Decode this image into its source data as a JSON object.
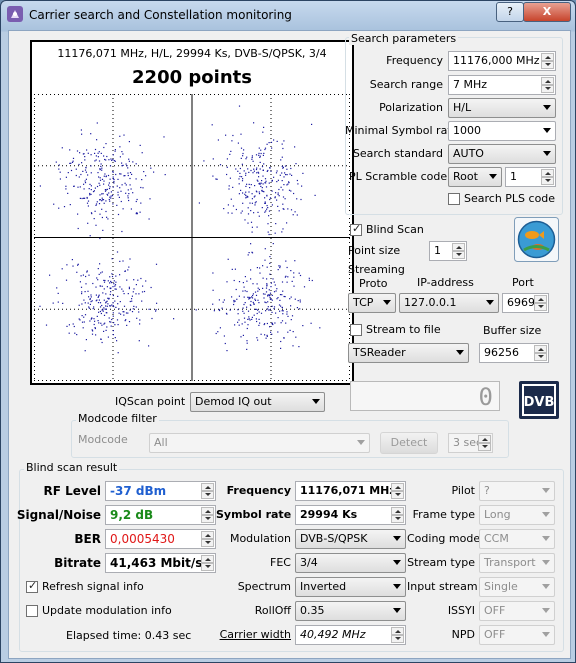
{
  "window": {
    "title": "Carrier search and Constellation monitoring",
    "help_label": "?",
    "close_label": "X"
  },
  "plot": {
    "header": "11176,071 MHz, H/L, 29994 Ks, DVB-S/QPSK, 3/4",
    "points_label": "2200 points"
  },
  "search_params": {
    "group_title": "Search parameters",
    "frequency_label": "Frequency",
    "frequency_value": "11176,000 MHz",
    "search_range_label": "Search range",
    "search_range_value": "7 MHz",
    "polarization_label": "Polarization",
    "polarization_value": "H/L",
    "min_symbol_rate_label": "Minimal Symbol rate",
    "min_symbol_rate_value": "1000",
    "search_standard_label": "Search standard",
    "search_standard_value": "AUTO",
    "pl_scramble_label": "PL Scramble code",
    "pl_scramble_mode": "Root",
    "pl_scramble_value": "1",
    "search_pls_label": "Search PLS code"
  },
  "blind": {
    "blind_scan_label": "Blind Scan",
    "point_size_label": "Point size",
    "point_size_value": "1"
  },
  "streaming": {
    "title": "Streaming",
    "proto_label": "Proto",
    "ip_label": "IP-address",
    "port_label": "Port",
    "proto_value": "TCP",
    "ip_value": "127.0.0.1",
    "port_value": "6969",
    "stream_to_file_label": "Stream to file",
    "buffer_size_label": "Buffer size",
    "reader_value": "TSReader",
    "buffer_size_value": "96256"
  },
  "iq": {
    "label": "IQScan point",
    "value": "Demod IQ out",
    "counter": "0"
  },
  "modcode": {
    "group_title": "Modcode filter",
    "label": "Modcode",
    "value": "All",
    "detect_label": "Detect",
    "interval_value": "3 sec"
  },
  "result": {
    "group_title": "Blind scan result",
    "rf_level_label": "RF Level",
    "rf_level_value": "-37 dBm",
    "snr_label": "Signal/Noise",
    "snr_value": "9,2 dB",
    "ber_label": "BER",
    "ber_value": "0,0005430",
    "bitrate_label": "Bitrate",
    "bitrate_value": "41,463 Mbit/s",
    "refresh_label": "Refresh signal info",
    "update_mod_label": "Update modulation info",
    "elapsed_label": "Elapsed time: 0.43 sec",
    "frequency_label": "Frequency",
    "frequency_value": "11176,071 MHz",
    "symbol_rate_label": "Symbol rate",
    "symbol_rate_value": "29994 Ks",
    "modulation_label": "Modulation",
    "modulation_value": "DVB-S/QPSK",
    "fec_label": "FEC",
    "fec_value": "3/4",
    "spectrum_label": "Spectrum",
    "spectrum_value": "Inverted",
    "rolloff_label": "RollOff",
    "rolloff_value": "0.35",
    "carrier_width_label": "Carrier width",
    "carrier_width_value": "40,492 MHz",
    "pilot_label": "Pilot",
    "pilot_value": "?",
    "frame_type_label": "Frame type",
    "frame_type_value": "Long",
    "coding_mode_label": "Coding mode",
    "coding_mode_value": "CCM",
    "stream_type_label": "Stream type",
    "stream_type_value": "Transport",
    "input_stream_label": "Input stream",
    "input_stream_value": "Single",
    "issyi_label": "ISSYI",
    "issyi_value": "OFF",
    "npd_label": "NPD",
    "npd_value": "OFF"
  },
  "colors": {
    "rf_level": "#1f5fd0",
    "snr": "#1a8a1a",
    "ber": "#e01818",
    "points": "#1a1aa0"
  },
  "icons": {
    "app": "satellite-dish-icon",
    "logo": "fish-logo-icon",
    "dvb": "dvb-logo-icon"
  }
}
